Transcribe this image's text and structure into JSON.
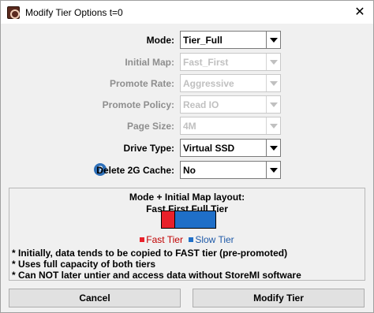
{
  "window": {
    "title": "Modify Tier Options t=0",
    "close_glyph": "✕"
  },
  "form": {
    "rows": [
      {
        "label": "Mode:",
        "value": "Tier_Full",
        "disabled": false
      },
      {
        "label": "Initial Map:",
        "value": "Fast_First",
        "disabled": true
      },
      {
        "label": "Promote Rate:",
        "value": "Aggressive",
        "disabled": true
      },
      {
        "label": "Promote Policy:",
        "value": "Read IO",
        "disabled": true
      },
      {
        "label": "Page Size:",
        "value": "4M",
        "disabled": true
      },
      {
        "label": "Drive Type:",
        "value": "Virtual SSD",
        "disabled": false
      },
      {
        "label": "Delete 2G Cache:",
        "value": "No",
        "disabled": false
      }
    ],
    "help_glyph": "?"
  },
  "panel": {
    "title": "Mode + Initial Map layout:",
    "subtitle": "Fast First Full Tier",
    "legend_fast": "Fast Tier",
    "legend_slow": "Slow Tier",
    "notes": [
      "* Initially, data tends to be copied to FAST tier (pre-promoted)",
      "* Uses full capacity of both tiers",
      "* Can NOT later untier and access data without StoreMI software"
    ],
    "colors": {
      "fast": "#e8202a",
      "slow": "#1f6fc8"
    }
  },
  "buttons": {
    "cancel": "Cancel",
    "modify": "Modify Tier"
  }
}
